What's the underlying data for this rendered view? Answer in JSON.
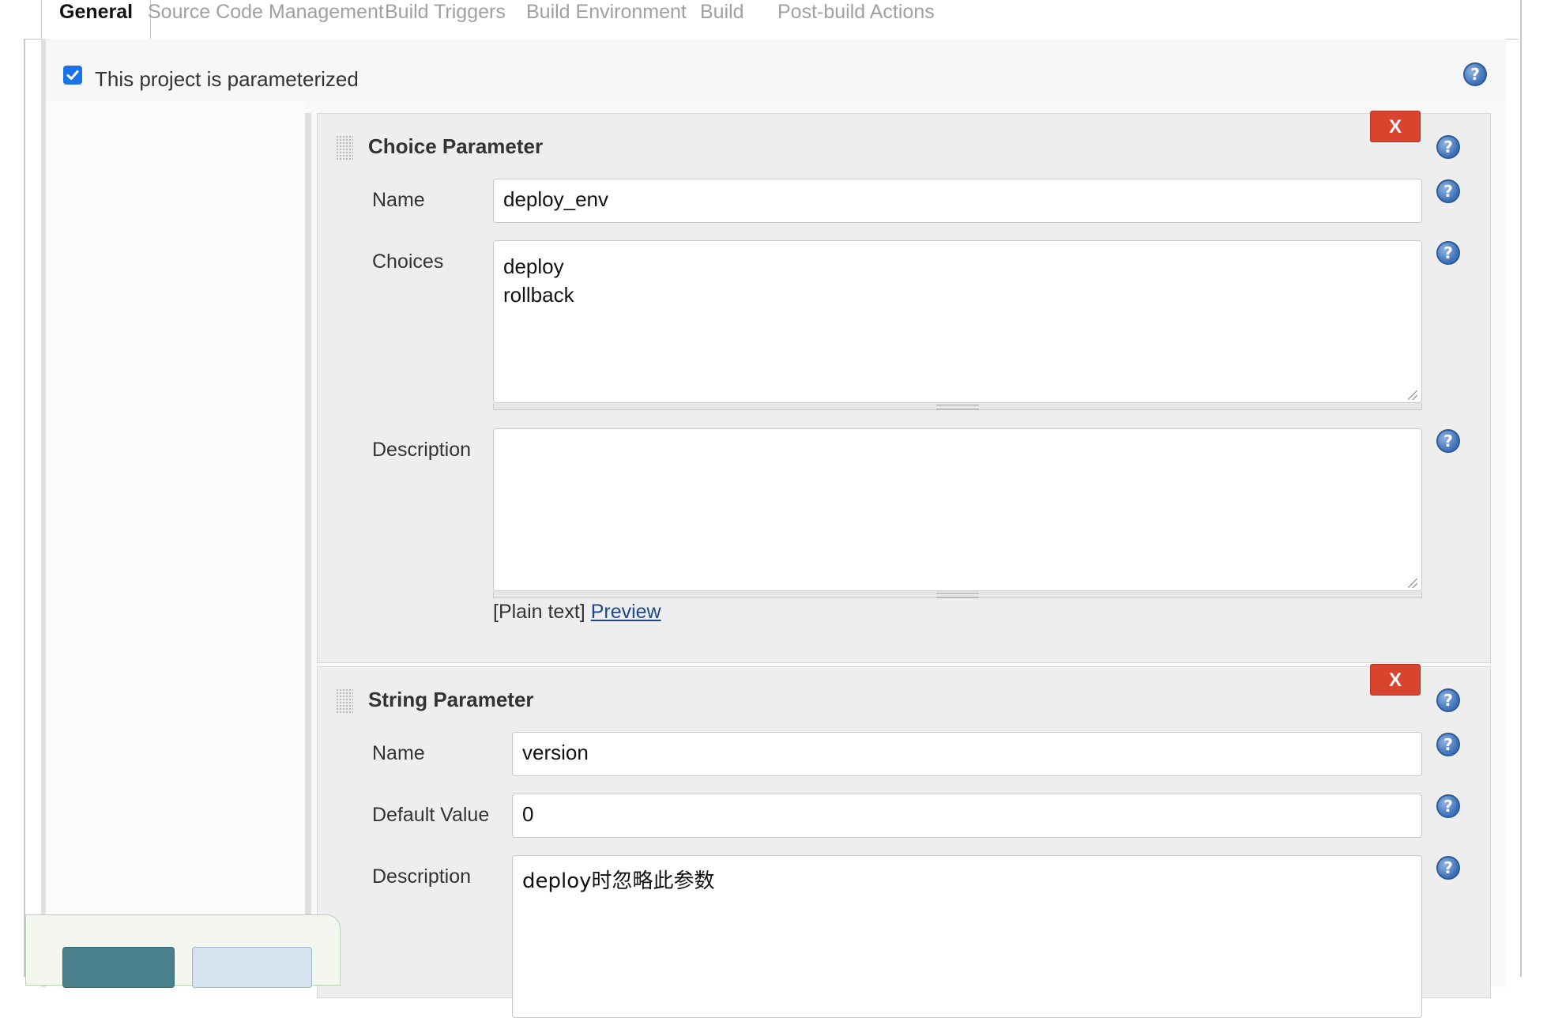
{
  "tabs": [
    {
      "label": "General"
    },
    {
      "label": "Source Code Management"
    },
    {
      "label": "Build Triggers"
    },
    {
      "label": "Build Environment"
    },
    {
      "label": "Build"
    },
    {
      "label": "Post-build Actions"
    }
  ],
  "parameterized": {
    "label": "This project is parameterized",
    "checked": true
  },
  "help_glyph": "?",
  "choice_param": {
    "title": "Choice Parameter",
    "delete_label": "X",
    "name_label": "Name",
    "name_value": "deploy_env",
    "choices_label": "Choices",
    "choices_value": "deploy\nrollback",
    "description_label": "Description",
    "description_value": "",
    "plain_text": "[Plain text]",
    "preview_link": "Preview"
  },
  "string_param": {
    "title": "String Parameter",
    "delete_label": "X",
    "name_label": "Name",
    "name_value": "version",
    "default_label": "Default Value",
    "default_value": "0",
    "description_label": "Description",
    "description_value": "deploy时忽略此参数"
  },
  "colors": {
    "delete_button": "#d9442f",
    "checkbox": "#1a73e8",
    "help_icon": "#3b6fb6",
    "link": "#204a87"
  }
}
